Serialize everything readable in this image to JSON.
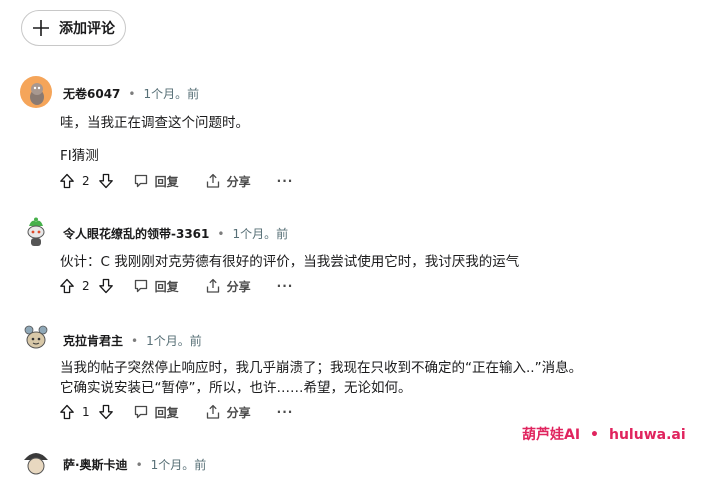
{
  "add_comment": {
    "label": "添加评论"
  },
  "comments": [
    {
      "author": "无卷6047",
      "time": "1个月。前",
      "lines": [
        "哇，当我正在调查这个问题时。",
        "FI猜测"
      ],
      "votes": "2",
      "reply": "回复",
      "share": "分享",
      "more": "···"
    },
    {
      "author": "令人眼花缭乱的领带-3361",
      "time": "1个月。前",
      "lines": [
        "伙计：C 我刚刚对克劳德有很好的评价，当我尝试使用它时，我讨厌我的运气"
      ],
      "votes": "2",
      "reply": "回复",
      "share": "分享",
      "more": "···"
    },
    {
      "author": "克拉肯君主",
      "time": "1个月。前",
      "lines": [
        "当我的帖子突然停止响应时，我几乎崩溃了；我现在只收到不确定的“正在输入..”消息。",
        "它确实说安装已“暂停”，所以，也许……希望，无论如何。"
      ],
      "votes": "1",
      "reply": "回复",
      "share": "分享",
      "more": "···"
    },
    {
      "author": "萨·奥斯卡迪",
      "time": "1个月。前"
    }
  ],
  "watermark": {
    "brand": "葫芦娃AI",
    "sep": "•",
    "site": "huluwa.ai"
  },
  "colors": {
    "watermark": "#e0245e",
    "avatar1": "#f5a55a",
    "time": "#576f76"
  }
}
